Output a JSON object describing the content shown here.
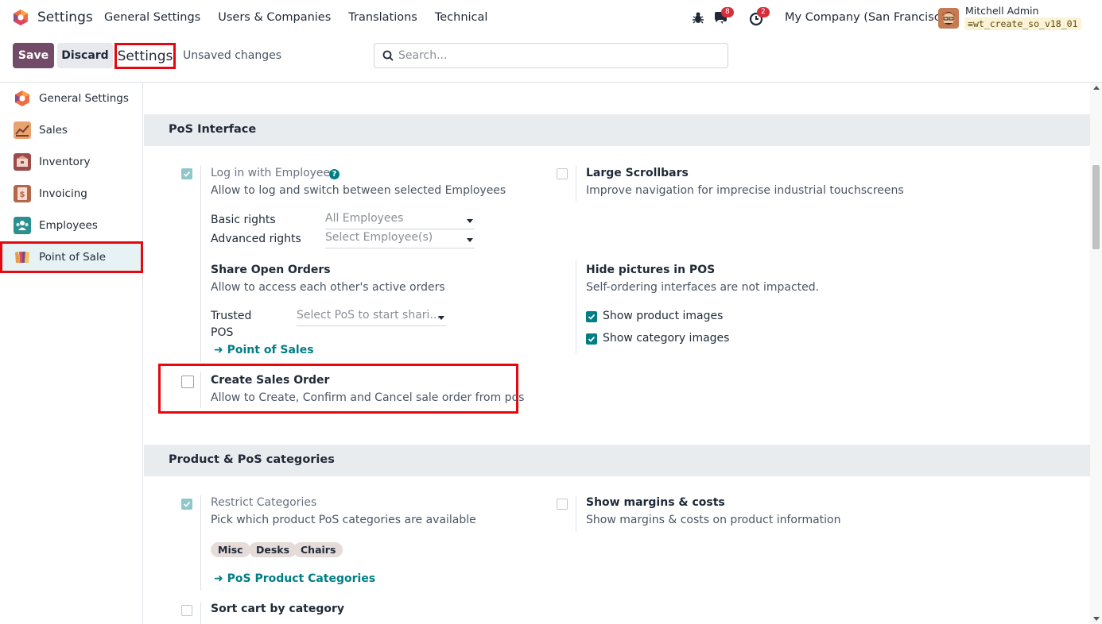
{
  "topnav": {
    "app_title": "Settings",
    "menu": [
      "General Settings",
      "Users & Companies",
      "Translations",
      "Technical"
    ],
    "messages_count": "8",
    "activities_count": "2",
    "company": "My Company (San Francisco)",
    "user_name": "Mitchell Admin",
    "database": "wt_create_so_v18_01",
    "icons": [
      "debug-bug-icon",
      "chat-icon",
      "clock-icon"
    ]
  },
  "control_bar": {
    "save_label": "Save",
    "discard_label": "Discard",
    "breadcrumb": "Settings",
    "status": "Unsaved changes",
    "search_placeholder": "Search..."
  },
  "sidebar": {
    "items": [
      {
        "label": "General Settings",
        "icon": "odoo-logo-icon"
      },
      {
        "label": "Sales",
        "icon": "sales-chart-icon"
      },
      {
        "label": "Inventory",
        "icon": "inventory-box-icon"
      },
      {
        "label": "Invoicing",
        "icon": "invoice-icon"
      },
      {
        "label": "Employees",
        "icon": "employees-icon"
      },
      {
        "label": "Point of Sale",
        "icon": "point-of-sale-icon"
      }
    ],
    "active": "Point of Sale"
  },
  "sections": {
    "pos_interface": {
      "title": "PoS Interface",
      "login_employees": {
        "title": "Log in with Employees",
        "desc": "Allow to log and switch between selected Employees",
        "checked": true,
        "basic_rights_label": "Basic rights",
        "basic_rights_value": "All Employees",
        "advanced_rights_label": "Advanced rights",
        "advanced_rights_value": "Select Employee(s)"
      },
      "large_scrollbars": {
        "title": "Large Scrollbars",
        "desc": "Improve navigation for imprecise industrial touchscreens",
        "checked": false
      },
      "share_open_orders": {
        "title": "Share Open Orders",
        "desc": "Allow to access each other's active orders",
        "trusted_label_1": "Trusted",
        "trusted_label_2": "POS",
        "trusted_placeholder": "Select PoS to start shari...",
        "link": "Point of Sales"
      },
      "hide_pictures": {
        "title": "Hide pictures in POS",
        "desc": "Self-ordering interfaces are not impacted.",
        "show_product_images": "Show product images",
        "show_category_images": "Show category images"
      },
      "create_sales_order": {
        "title": "Create Sales Order",
        "desc": "Allow to Create, Confirm and Cancel sale order from pos",
        "checked": false
      }
    },
    "categories": {
      "title": "Product & PoS categories",
      "restrict_categories": {
        "title": "Restrict Categories",
        "desc": "Pick which product PoS categories are available",
        "checked": true,
        "tags": [
          "Misc",
          "Desks",
          "Chairs"
        ],
        "link": "PoS Product Categories"
      },
      "show_margins": {
        "title": "Show margins & costs",
        "desc": "Show margins & costs on product information",
        "checked": false
      },
      "sort_cart": {
        "title": "Sort cart by category",
        "checked": false
      }
    }
  },
  "colors": {
    "brand": "#714b67",
    "accent": "#017e84",
    "highlight": "#e5080f"
  }
}
